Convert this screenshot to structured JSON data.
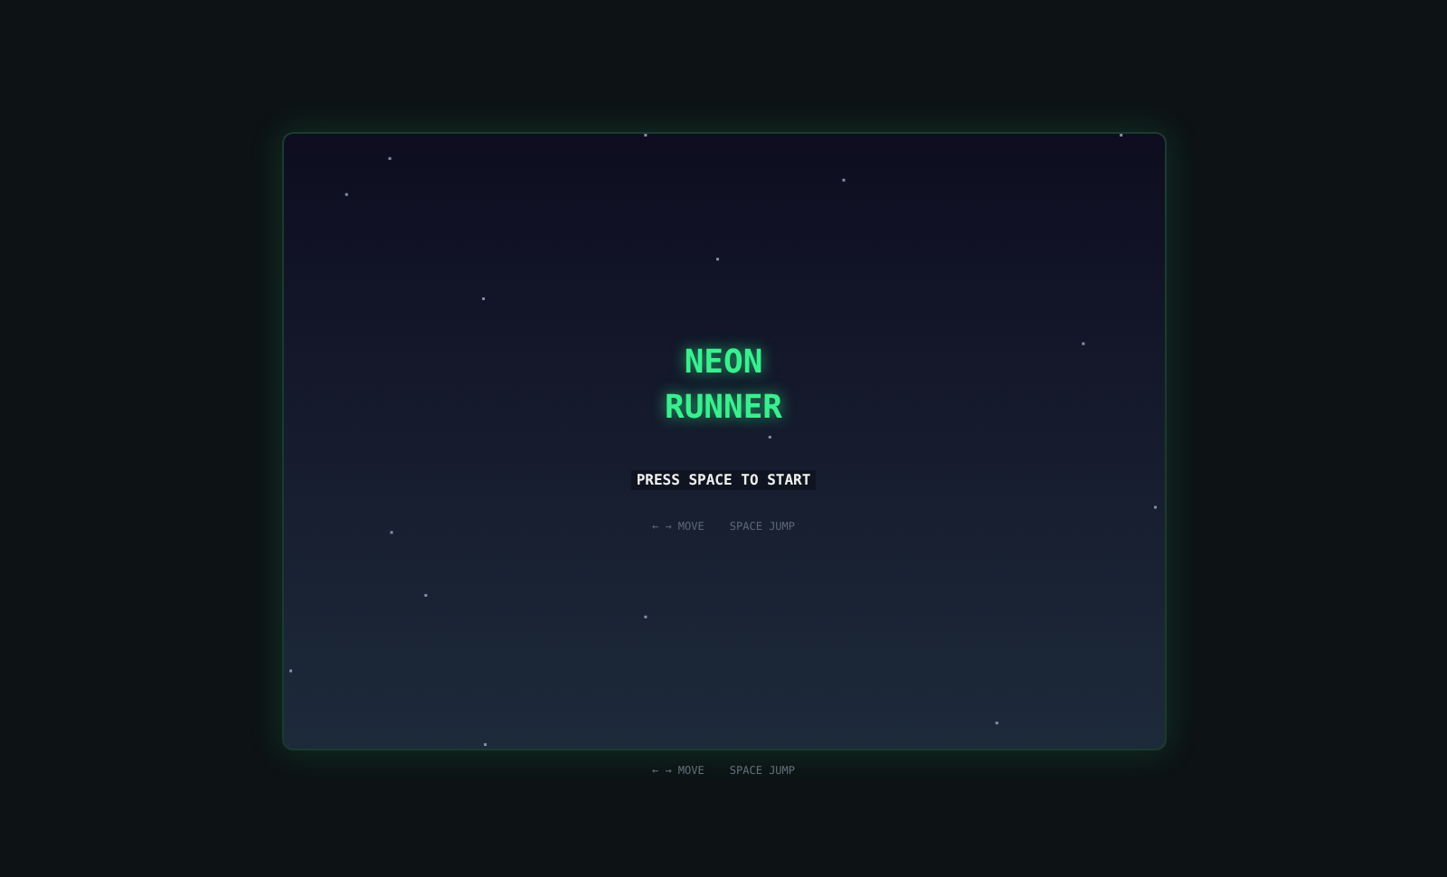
{
  "game": {
    "title": "NEON RUNNER",
    "prompt": "PRESS SPACE TO START",
    "hints": [
      "← → MOVE",
      "SPACE JUMP"
    ]
  },
  "footer": {
    "hints": [
      "← → MOVE",
      "SPACE JUMP"
    ]
  }
}
